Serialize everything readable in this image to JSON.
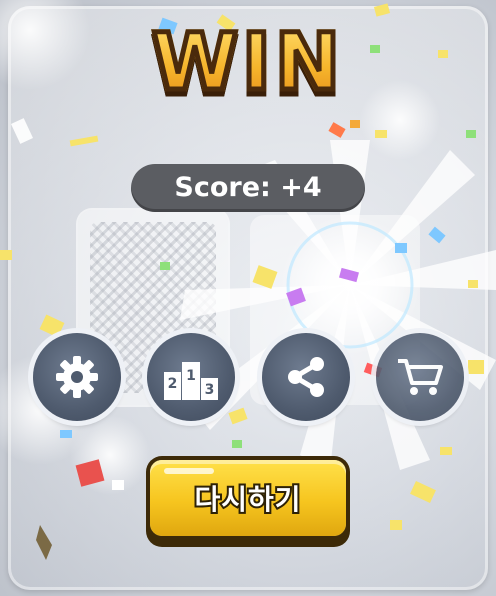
{
  "title": "WIN",
  "score": {
    "label": "Score: +4"
  },
  "buttons": {
    "settings": "settings",
    "ranking": "ranking",
    "share": "share",
    "shop": "shop",
    "ranking_digits": [
      "2",
      "1",
      "3"
    ]
  },
  "retry": {
    "label": "다시하기"
  },
  "colors": {
    "title": "#f6b52c",
    "title_outline": "#4a2a0c",
    "score_pill": "#5b5d62",
    "icon_button": "#4f5b6e",
    "retry_button": "#f6c51f"
  },
  "icons": [
    "gear-icon",
    "podium-icon",
    "share-icon",
    "cart-icon"
  ]
}
